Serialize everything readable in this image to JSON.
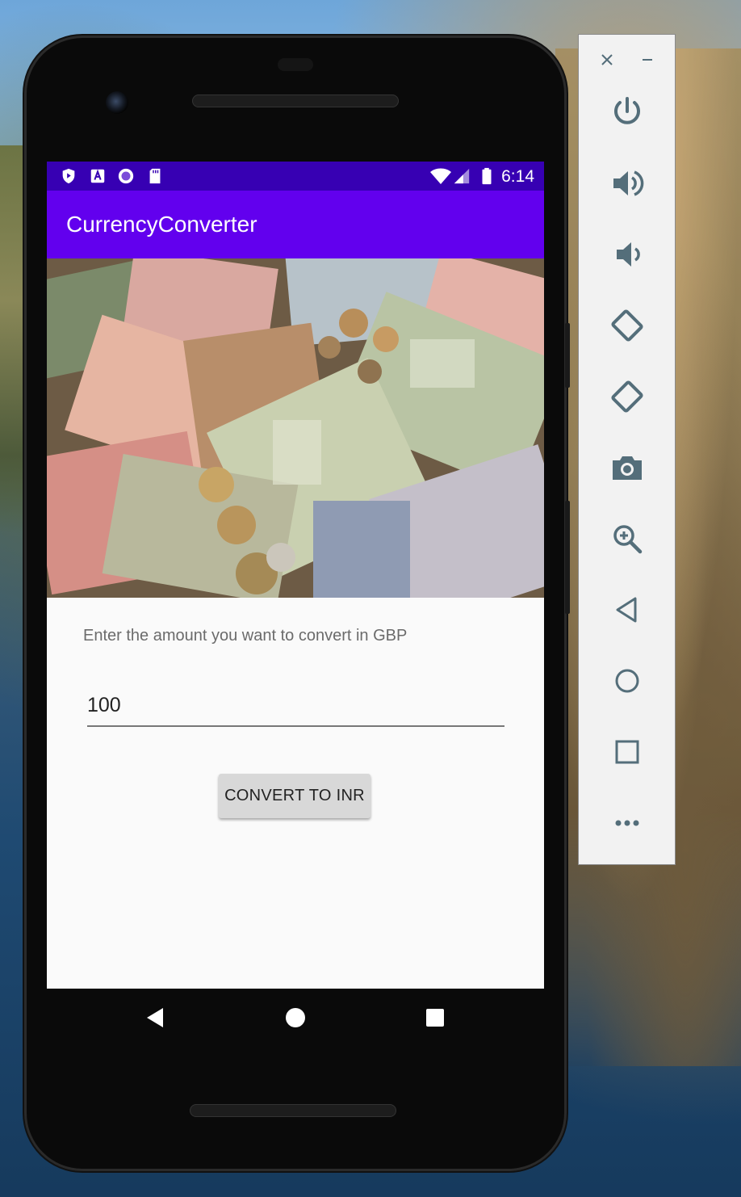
{
  "app": {
    "title": "CurrencyConverter"
  },
  "status_bar": {
    "time": "6:14",
    "left_icons": [
      "shield-icon",
      "font-a-icon",
      "circle-record-icon",
      "sd-card-icon"
    ],
    "right_icons": [
      "wifi-icon",
      "signal-icon",
      "battery-icon"
    ]
  },
  "form": {
    "instruction": "Enter the amount you want to convert in GBP",
    "amount_value": "100",
    "convert_label": "CONVERT TO INR"
  },
  "nav": [
    "back-icon",
    "home-icon",
    "recents-icon"
  ],
  "emulator_toolbar": {
    "window_controls": [
      "close-icon",
      "minimize-icon"
    ],
    "items": [
      "power-icon",
      "volume-up-icon",
      "volume-down-icon",
      "rotate-left-icon",
      "rotate-right-icon",
      "camera-icon",
      "zoom-icon",
      "back-icon",
      "home-icon",
      "overview-icon",
      "more-icon"
    ]
  },
  "colors": {
    "status_bar": "#3700b3",
    "app_bar": "#6200ee",
    "screen_bg": "#fafafa",
    "button_bg": "#d8d8d8",
    "emulator_icon": "#546e7a"
  }
}
